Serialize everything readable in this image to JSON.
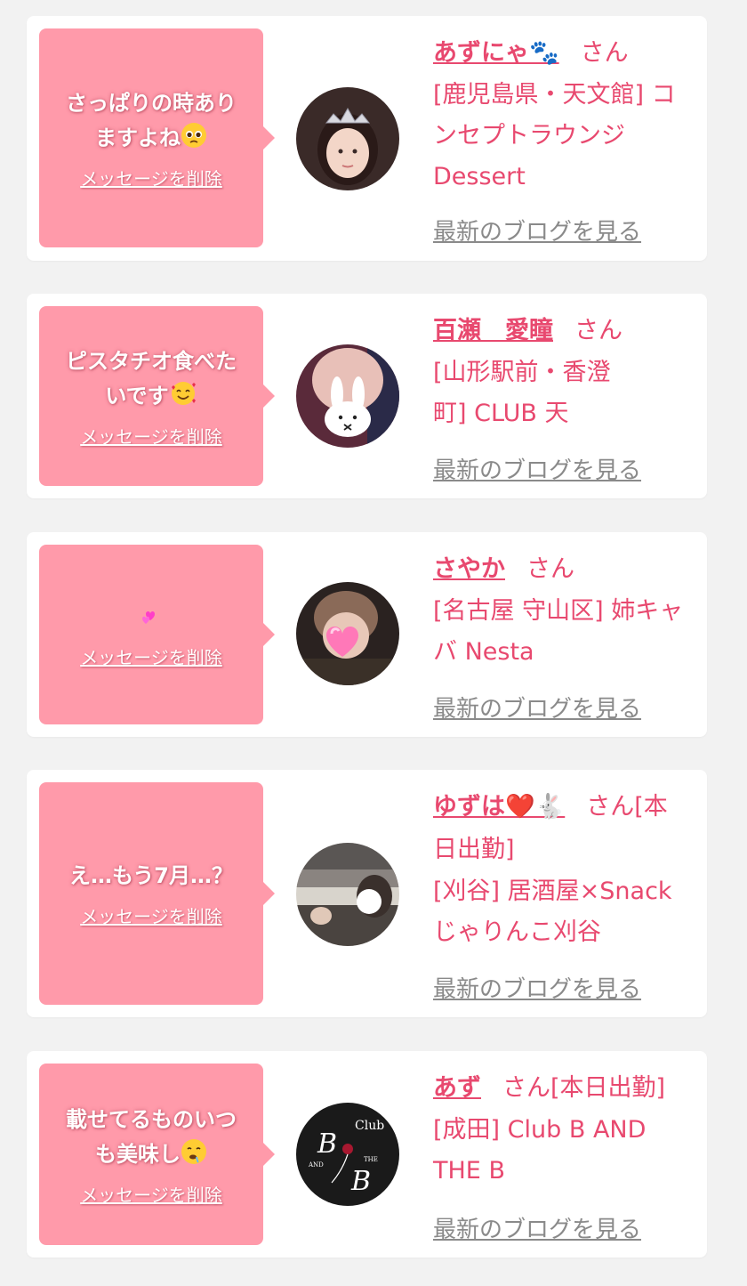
{
  "colors": {
    "accent": "#e8496f",
    "bubble": "#ff9aaa",
    "link_gray": "#8a8a8a",
    "background": "#f2f2f2"
  },
  "delete_label": "メッセージを削除",
  "blog_label": "最新のブログを見る",
  "cards": [
    {
      "message_lines": [
        "さっぱりの時あり",
        "ますよね"
      ],
      "message_emoji": "pleading-face-emoji",
      "name": "あずにゃ🐾",
      "suffix": "さん",
      "shop_lines": [
        "[鹿児島県・天文館] コ",
        "ンセプトラウンジ",
        "Dessert"
      ],
      "avatar": "avatar-tiara-girl"
    },
    {
      "message_lines": [
        "ピスタチオ食べた",
        "いです"
      ],
      "message_emoji": "smiling-face-with-hearts-emoji",
      "name": "百瀬　愛瞳",
      "suffix": "さん",
      "shop_lines": [
        "[山形駅前・香澄",
        "町] CLUB 天"
      ],
      "avatar": "avatar-bunny-sticker"
    },
    {
      "message_lines": [
        ""
      ],
      "message_emoji": "two-hearts-emoji",
      "name": "さやか",
      "suffix": "さん",
      "shop_lines": [
        "[名古屋 守山区] 姉キャ",
        "バ Nesta"
      ],
      "avatar": "avatar-heart-sticker"
    },
    {
      "message_lines": [
        "え…もう7月…？"
      ],
      "message_emoji": "",
      "name": "ゆずは❤️🐇",
      "suffix": "さん[本",
      "suffix2": "日出勤]",
      "shop_lines": [
        "[刈谷] 居酒屋×Snack",
        "じゃりんこ刈谷"
      ],
      "avatar": "avatar-car-selfie"
    },
    {
      "message_lines": [
        "載せてるものいつ",
        "も美味し"
      ],
      "message_emoji": "drooling-face-emoji",
      "name": "あず",
      "suffix": "さん[本日出勤]",
      "shop_lines": [
        "[成田] Club B AND",
        "THE B"
      ],
      "avatar": "avatar-club-logo",
      "logo_text": [
        "Club",
        "B",
        "AND",
        "THE",
        "B"
      ]
    }
  ]
}
